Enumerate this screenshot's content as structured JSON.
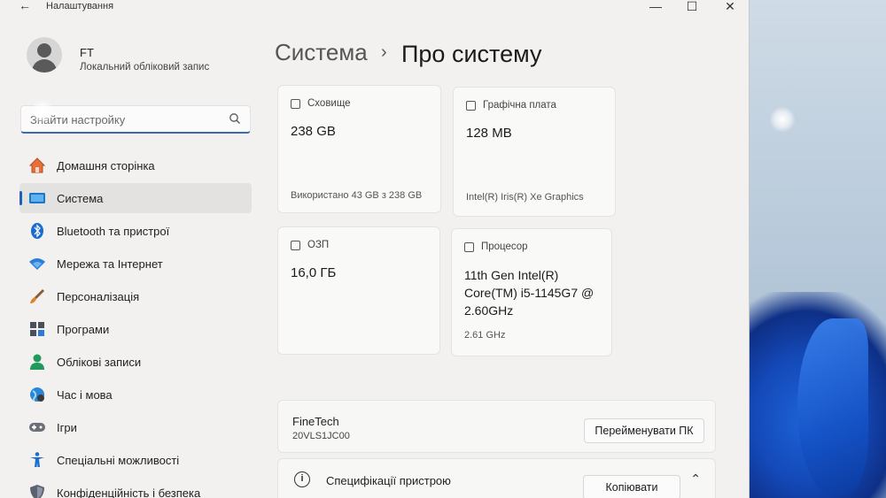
{
  "window": {
    "title": "Налаштування",
    "back_icon": "←",
    "minimize_icon": "—",
    "maximize_icon": "☐",
    "close_icon": "✕"
  },
  "profile": {
    "name": "FT",
    "account_type": "Локальний обліковий запис"
  },
  "search": {
    "placeholder": "Знайти настройку"
  },
  "sidebar": {
    "items": [
      {
        "label": "Домашня сторінка",
        "icon": "home-icon"
      },
      {
        "label": "Система",
        "icon": "system-icon",
        "active": true
      },
      {
        "label": "Bluetooth та пристрої",
        "icon": "bluetooth-icon"
      },
      {
        "label": "Мережа та Інтернет",
        "icon": "wifi-icon"
      },
      {
        "label": "Персоналізація",
        "icon": "brush-icon"
      },
      {
        "label": "Програми",
        "icon": "apps-icon"
      },
      {
        "label": "Облікові записи",
        "icon": "person-icon"
      },
      {
        "label": "Час і мова",
        "icon": "globe-icon"
      },
      {
        "label": "Ігри",
        "icon": "gamepad-icon"
      },
      {
        "label": "Спеціальні можливості",
        "icon": "accessibility-icon"
      },
      {
        "label": "Конфіденційність і безпека",
        "icon": "shield-icon"
      }
    ]
  },
  "breadcrumb": {
    "parent": "Система",
    "separator": "›",
    "current": "Про систему"
  },
  "cards": {
    "storage": {
      "title": "Сховище",
      "value": "238 GB",
      "sub": "Використано 43 GB з 238 GB"
    },
    "graphics": {
      "title": "Графічна плата",
      "value": "128 MB",
      "sub": "Intel(R) Iris(R) Xe Graphics"
    },
    "ram": {
      "title": "ОЗП",
      "value": "16,0 ГБ"
    },
    "cpu": {
      "title": "Процесор",
      "value_lines": [
        "11th Gen Intel(R)",
        "Core(TM) i5-1145G7 @",
        "2.60GHz"
      ],
      "sub": "2.61 GHz"
    }
  },
  "device": {
    "name": "FineTech",
    "model": "20VLS1JC00",
    "rename_label": "Перейменувати ПК"
  },
  "specs": {
    "label": "Специфікації пристрою",
    "copy_label": "Копіювати",
    "info_icon": "i",
    "chevron": "⌃"
  }
}
